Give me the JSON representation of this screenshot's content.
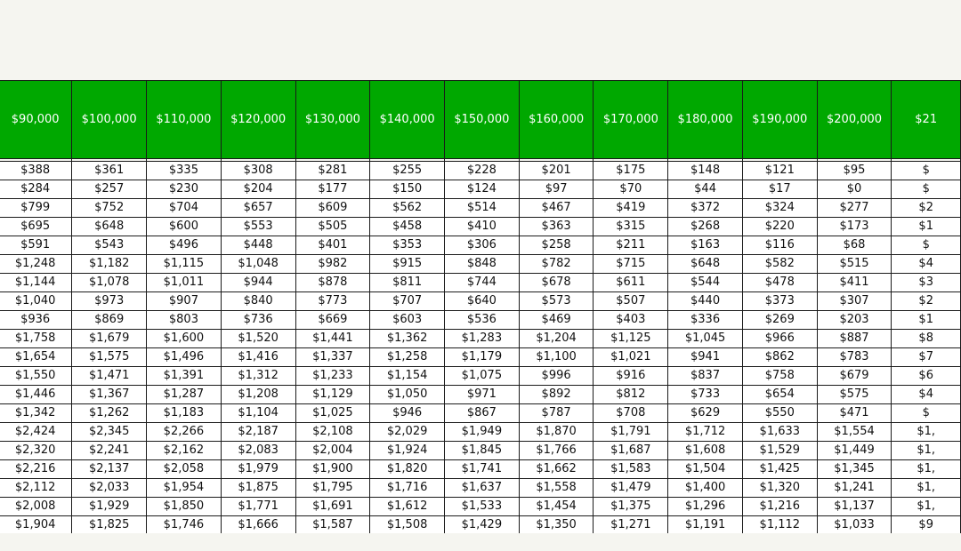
{
  "headers": [
    "$90,000",
    "$100,000",
    "$110,000",
    "$120,000",
    "$130,000",
    "$140,000",
    "$150,000",
    "$160,000",
    "$170,000",
    "$180,000",
    "$190,000",
    "$200,000",
    "$21"
  ],
  "rows": [
    [
      "$388",
      "$361",
      "$335",
      "$308",
      "$281",
      "$255",
      "$228",
      "$201",
      "$175",
      "$148",
      "$121",
      "$95",
      "$"
    ],
    [
      "$284",
      "$257",
      "$230",
      "$204",
      "$177",
      "$150",
      "$124",
      "$97",
      "$70",
      "$44",
      "$17",
      "$0",
      "$"
    ],
    [
      "$799",
      "$752",
      "$704",
      "$657",
      "$609",
      "$562",
      "$514",
      "$467",
      "$419",
      "$372",
      "$324",
      "$277",
      "$2"
    ],
    [
      "$695",
      "$648",
      "$600",
      "$553",
      "$505",
      "$458",
      "$410",
      "$363",
      "$315",
      "$268",
      "$220",
      "$173",
      "$1"
    ],
    [
      "$591",
      "$543",
      "$496",
      "$448",
      "$401",
      "$353",
      "$306",
      "$258",
      "$211",
      "$163",
      "$116",
      "$68",
      "$"
    ],
    [
      "$1,248",
      "$1,182",
      "$1,115",
      "$1,048",
      "$982",
      "$915",
      "$848",
      "$782",
      "$715",
      "$648",
      "$582",
      "$515",
      "$4"
    ],
    [
      "$1,144",
      "$1,078",
      "$1,011",
      "$944",
      "$878",
      "$811",
      "$744",
      "$678",
      "$611",
      "$544",
      "$478",
      "$411",
      "$3"
    ],
    [
      "$1,040",
      "$973",
      "$907",
      "$840",
      "$773",
      "$707",
      "$640",
      "$573",
      "$507",
      "$440",
      "$373",
      "$307",
      "$2"
    ],
    [
      "$936",
      "$869",
      "$803",
      "$736",
      "$669",
      "$603",
      "$536",
      "$469",
      "$403",
      "$336",
      "$269",
      "$203",
      "$1"
    ],
    [
      "$1,758",
      "$1,679",
      "$1,600",
      "$1,520",
      "$1,441",
      "$1,362",
      "$1,283",
      "$1,204",
      "$1,125",
      "$1,045",
      "$966",
      "$887",
      "$8"
    ],
    [
      "$1,654",
      "$1,575",
      "$1,496",
      "$1,416",
      "$1,337",
      "$1,258",
      "$1,179",
      "$1,100",
      "$1,021",
      "$941",
      "$862",
      "$783",
      "$7"
    ],
    [
      "$1,550",
      "$1,471",
      "$1,391",
      "$1,312",
      "$1,233",
      "$1,154",
      "$1,075",
      "$996",
      "$916",
      "$837",
      "$758",
      "$679",
      "$6"
    ],
    [
      "$1,446",
      "$1,367",
      "$1,287",
      "$1,208",
      "$1,129",
      "$1,050",
      "$971",
      "$892",
      "$812",
      "$733",
      "$654",
      "$575",
      "$4"
    ],
    [
      "$1,342",
      "$1,262",
      "$1,183",
      "$1,104",
      "$1,025",
      "$946",
      "$867",
      "$787",
      "$708",
      "$629",
      "$550",
      "$471",
      "$"
    ],
    [
      "$2,424",
      "$2,345",
      "$2,266",
      "$2,187",
      "$2,108",
      "$2,029",
      "$1,949",
      "$1,870",
      "$1,791",
      "$1,712",
      "$1,633",
      "$1,554",
      "$1,"
    ],
    [
      "$2,320",
      "$2,241",
      "$2,162",
      "$2,083",
      "$2,004",
      "$1,924",
      "$1,845",
      "$1,766",
      "$1,687",
      "$1,608",
      "$1,529",
      "$1,449",
      "$1,"
    ],
    [
      "$2,216",
      "$2,137",
      "$2,058",
      "$1,979",
      "$1,900",
      "$1,820",
      "$1,741",
      "$1,662",
      "$1,583",
      "$1,504",
      "$1,425",
      "$1,345",
      "$1,"
    ],
    [
      "$2,112",
      "$2,033",
      "$1,954",
      "$1,875",
      "$1,795",
      "$1,716",
      "$1,637",
      "$1,558",
      "$1,479",
      "$1,400",
      "$1,320",
      "$1,241",
      "$1,"
    ],
    [
      "$2,008",
      "$1,929",
      "$1,850",
      "$1,771",
      "$1,691",
      "$1,612",
      "$1,533",
      "$1,454",
      "$1,375",
      "$1,296",
      "$1,216",
      "$1,137",
      "$1,"
    ],
    [
      "$1,904",
      "$1,825",
      "$1,746",
      "$1,666",
      "$1,587",
      "$1,508",
      "$1,429",
      "$1,350",
      "$1,271",
      "$1,191",
      "$1,112",
      "$1,033",
      "$9"
    ]
  ],
  "colors": {
    "header_bg": "#00a800",
    "header_text": "#ffffff",
    "grid": "#1a1a1a",
    "page_bg": "#f5f5f0"
  }
}
